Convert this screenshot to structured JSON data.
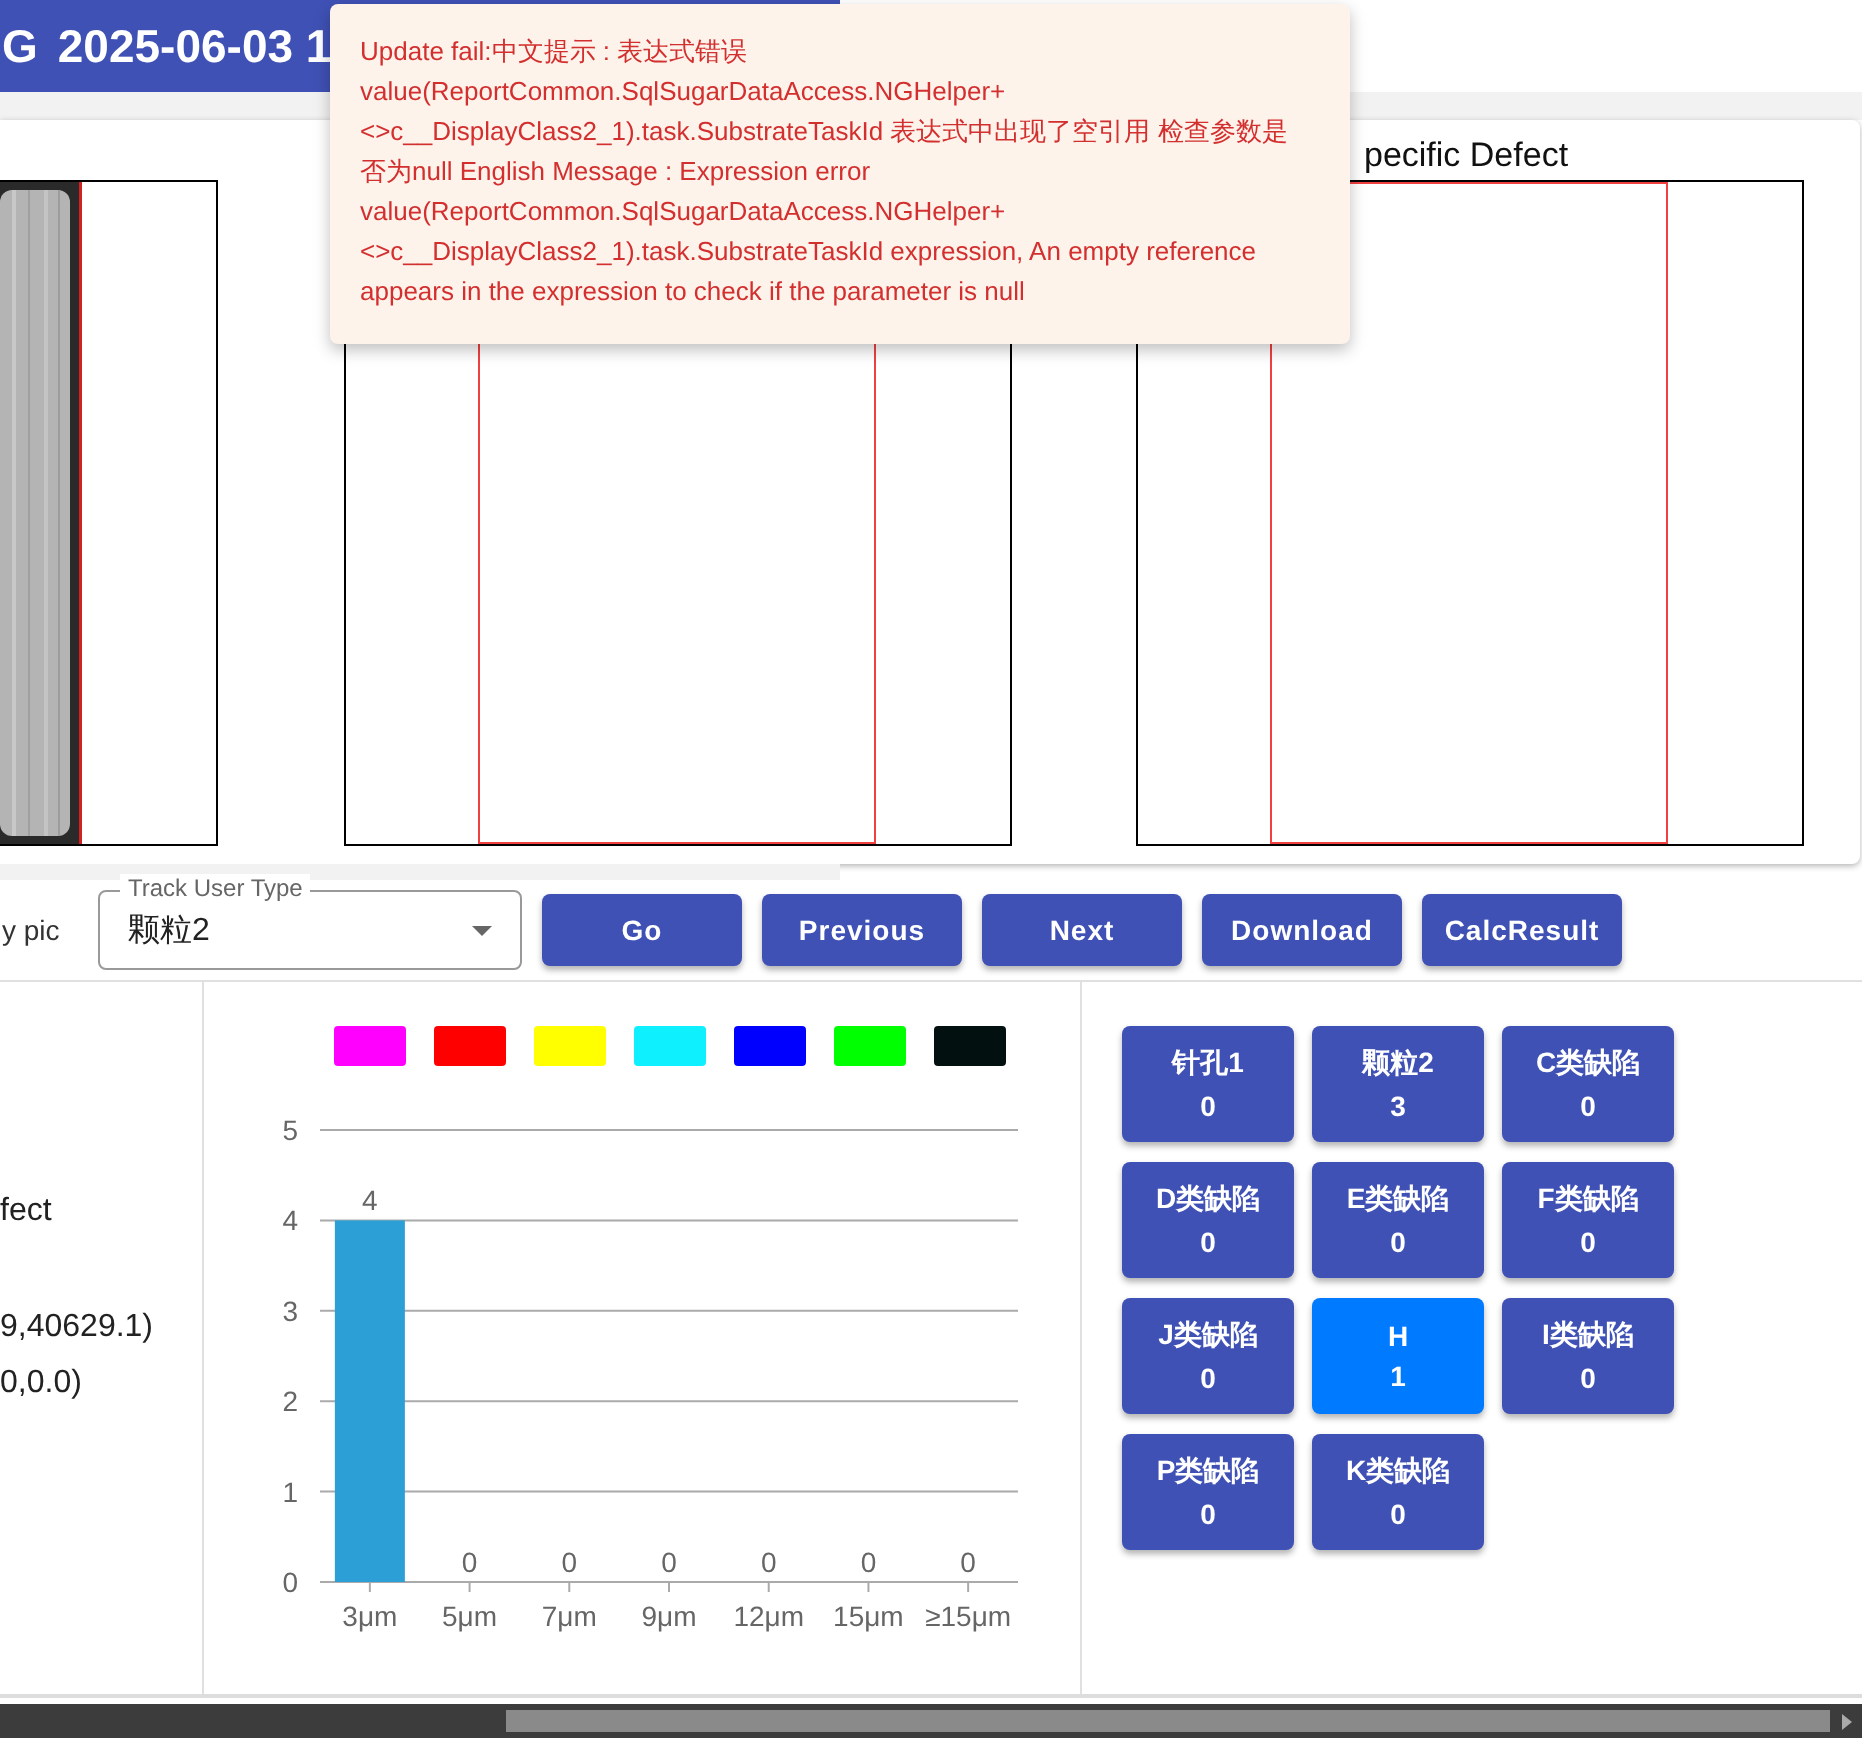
{
  "header": {
    "title_prefix": "G",
    "title": "2025-06-03 1"
  },
  "toast": {
    "message": "Update fail:中文提示 : 表达式错误 value(ReportCommon.SqlSugarDataAccess.NGHelper+<>c__DisplayClass2_1).task.SubstrateTaskId 表达式中出现了空引用 检查参数是否为null English Message : Expression error value(ReportCommon.SqlSugarDataAccess.NGHelper+<>c__DisplayClass2_1).task.SubstrateTaskId expression, An empty reference appears in the expression to check if the parameter is null"
  },
  "image_panels": {
    "panel_3_title": "pecific Defect"
  },
  "controls": {
    "left_label": "y pic",
    "select": {
      "label": "Track User Type",
      "value": "颗粒2"
    },
    "buttons": [
      "Go",
      "Previous",
      "Next",
      "Download",
      "CalcResult"
    ]
  },
  "info_lines": [
    "fect",
    "9,40629.1)",
    "0,0.0)"
  ],
  "legend": [
    {
      "color": "#ff00ff"
    },
    {
      "color": "#ff0000"
    },
    {
      "color": "#ffff00"
    },
    {
      "color": "#0ff0ff"
    },
    {
      "color": "#0000ff"
    },
    {
      "color": "#00ff00"
    },
    {
      "color": "#031010"
    }
  ],
  "chart_data": {
    "type": "bar",
    "categories": [
      "3μm",
      "5μm",
      "7μm",
      "9μm",
      "12μm",
      "15μm",
      "≥15μm"
    ],
    "series": [
      {
        "color": "#2b9fd6",
        "values": [
          4,
          0,
          0,
          0,
          0,
          0,
          0
        ]
      }
    ],
    "ylim": [
      0,
      5
    ],
    "yticks": [
      0,
      1,
      2,
      3,
      4,
      5
    ],
    "grid": true,
    "data_labels": true
  },
  "defects": [
    {
      "label": "针孔1",
      "count": "0",
      "selected": false
    },
    {
      "label": "颗粒2",
      "count": "3",
      "selected": false
    },
    {
      "label": "C类缺陷",
      "count": "0",
      "selected": false
    },
    {
      "label": "D类缺陷",
      "count": "0",
      "selected": false
    },
    {
      "label": "E类缺陷",
      "count": "0",
      "selected": false
    },
    {
      "label": "F类缺陷",
      "count": "0",
      "selected": false
    },
    {
      "label": "J类缺陷",
      "count": "0",
      "selected": false
    },
    {
      "label": "H",
      "count": "1",
      "selected": true
    },
    {
      "label": "I类缺陷",
      "count": "0",
      "selected": false
    },
    {
      "label": "P类缺陷",
      "count": "0",
      "selected": false
    },
    {
      "label": "K类缺陷",
      "count": "0",
      "selected": false
    }
  ]
}
